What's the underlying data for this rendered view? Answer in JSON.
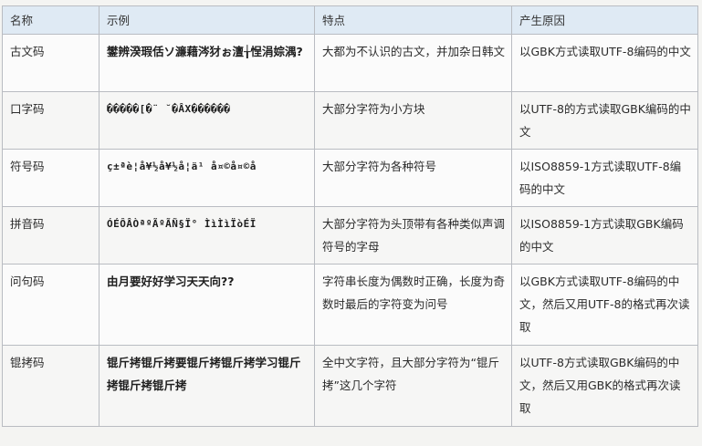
{
  "table": {
    "headers": {
      "name": "名称",
      "example": "示例",
      "feature": "特点",
      "cause": "产生原因"
    },
    "rows": [
      {
        "name": "古文码",
        "example": "鐢辨湀瑕佸ソ濂藉涔犲ぉ澶╁悜涓婃湡?",
        "feature": "大都为不认识的古文，并加杂日韩文",
        "cause": "以GBK方式读取UTF-8编码的中文"
      },
      {
        "name": "口字码",
        "example": "�����[�¨ ˘�ÂX������",
        "feature": "大部分字符为小方块",
        "cause": "以UTF-8的方式读取GBK编码的中文"
      },
      {
        "name": "符号码",
        "example": "ç±ªè¦å¥½å¥½å­¦ä¹ å¤©å¤©å",
        "feature": "大部分字符为各种符号",
        "cause": "以ISO8859-1方式读取UTF-8编码的中文"
      },
      {
        "name": "拼音码",
        "example": "ÓÉÔÂÒªºÃºÃÑ§Ï° ÌìÌìÏòÉÏ",
        "feature": "大部分字符为头顶带有各种类似声调符号的字母",
        "cause": "以ISO8859-1方式读取GBK编码的中文"
      },
      {
        "name": "问句码",
        "example": "由月要好好学习天天向??",
        "feature": "字符串长度为偶数时正确，长度为奇数时最后的字符变为问号",
        "cause": "以GBK方式读取UTF-8编码的中文，然后又用UTF-8的格式再次读取"
      },
      {
        "name": "锟拷码",
        "example": "锟斤拷锟斤拷要锟斤拷锟斤拷学习锟斤拷锟斤拷锟斤拷",
        "feature": "全中文字符，且大部分字符为“锟斤拷”这几个字符",
        "cause": "以UTF-8方式读取GBK编码的中文，然后又用GBK的格式再次读取"
      }
    ]
  }
}
